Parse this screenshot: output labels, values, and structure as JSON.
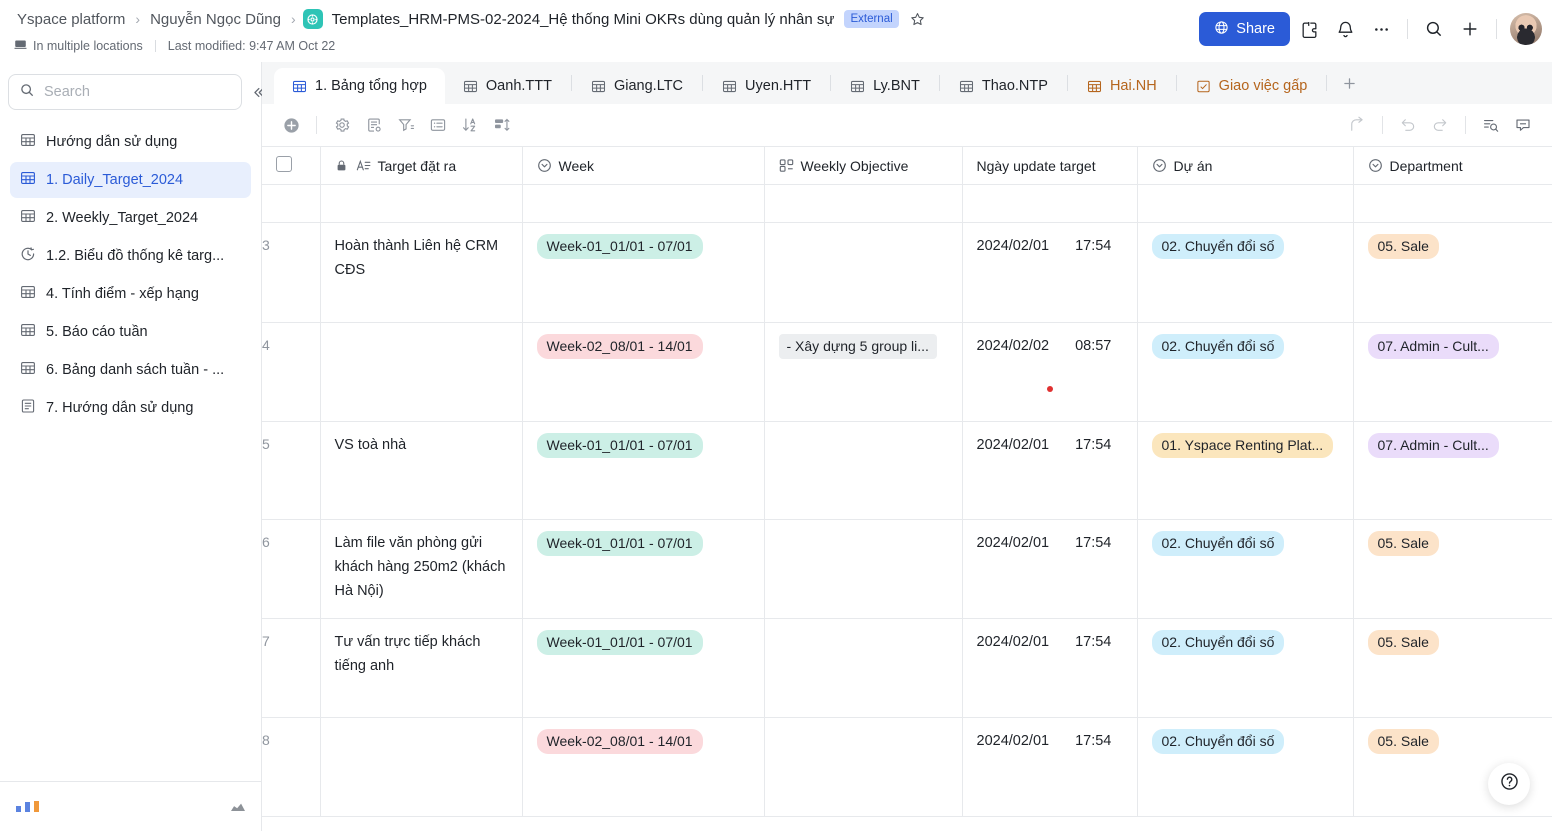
{
  "header": {
    "breadcrumbs": [
      {
        "label": "Yspace platform",
        "icon": ""
      },
      {
        "label": "Nguyễn Ngọc Dũng",
        "icon": ""
      }
    ],
    "separator": "›",
    "doc_icon": "base-table-icon",
    "doc_title": "Templates_HRM-PMS-02-2024_Hệ thống Mini OKRs dùng quản lý nhân sự",
    "external_badge": "External",
    "star_icon": "star-outline-icon",
    "location_icon": "multiple-locations-icon",
    "location_text": "In multiple locations",
    "last_modified": "Last modified: 9:47 AM Oct 22",
    "share_label": "Share",
    "share_icon": "globe-icon",
    "share_color": "#2b5bd7",
    "actions": [
      {
        "name": "extensions-icon"
      },
      {
        "name": "bell-icon"
      },
      {
        "name": "more-horizontal-icon"
      },
      {
        "name": "search-icon"
      },
      {
        "name": "plus-icon"
      }
    ],
    "avatar": "user-avatar"
  },
  "sidebar": {
    "search": {
      "placeholder": "Search",
      "value": "",
      "icon": "search-icon"
    },
    "collapse_icon": "chevrons-left-icon",
    "items": [
      {
        "label": "Hướng dẫn sử dụng",
        "icon": "grid-table-icon",
        "active": false
      },
      {
        "label": "1. Daily_Target_2024",
        "icon": "grid-table-icon",
        "active": true
      },
      {
        "label": "2. Weekly_Target_2024",
        "icon": "grid-table-icon",
        "active": false
      },
      {
        "label": "1.2. Biểu đồ thống kê targ...",
        "icon": "dashboard-clock-icon",
        "active": false
      },
      {
        "label": "4. Tính điểm - xếp hạng",
        "icon": "grid-table-icon",
        "active": false
      },
      {
        "label": "5. Báo cáo tuần",
        "icon": "grid-table-icon",
        "active": false
      },
      {
        "label": "6. Bảng danh sách tuần - ...",
        "icon": "grid-table-icon",
        "active": false
      },
      {
        "label": "7. Hướng dẫn sử dụng",
        "icon": "document-icon",
        "active": false
      }
    ]
  },
  "tabs": {
    "items": [
      {
        "label": "1. Bảng tổng hợp",
        "icon": "grid-table-icon",
        "active": true,
        "warn": false
      },
      {
        "label": "Oanh.TTT",
        "icon": "grid-table-icon",
        "active": false,
        "warn": false
      },
      {
        "label": "Giang.LTC",
        "icon": "grid-table-icon",
        "active": false,
        "warn": false
      },
      {
        "label": "Uyen.HTT",
        "icon": "grid-table-icon",
        "active": false,
        "warn": false
      },
      {
        "label": "Ly.BNT",
        "icon": "grid-table-icon",
        "active": false,
        "warn": false
      },
      {
        "label": "Thao.NTP",
        "icon": "grid-table-icon",
        "active": false,
        "warn": false
      },
      {
        "label": "Hai.NH",
        "icon": "grid-table-icon",
        "active": false,
        "warn": true
      },
      {
        "label": "Giao việc gấp",
        "icon": "checklist-icon",
        "active": false,
        "warn": true
      }
    ],
    "add_icon": "plus-icon",
    "warn_color": "#b5651d"
  },
  "toolbar": {
    "left": [
      {
        "name": "add-record-icon"
      },
      {
        "name": "settings-gear-icon"
      },
      {
        "name": "form-settings-icon"
      },
      {
        "name": "filter-icon"
      },
      {
        "name": "field-config-icon"
      },
      {
        "name": "sort-az-icon"
      },
      {
        "name": "group-icon"
      }
    ],
    "right": [
      {
        "name": "share-arrow-icon",
        "disabled": true
      },
      {
        "name": "undo-icon",
        "disabled": true
      },
      {
        "name": "redo-icon",
        "disabled": true
      },
      {
        "name": "find-replace-icon",
        "disabled": false
      },
      {
        "name": "comment-icon",
        "disabled": false
      }
    ]
  },
  "grid": {
    "select_all": {
      "checked": false
    },
    "columns": [
      {
        "label": "Target đặt ra",
        "icon": "text-field-icon",
        "locked": true
      },
      {
        "label": "Week",
        "icon": "single-select-icon",
        "locked": false
      },
      {
        "label": "Weekly Objective",
        "icon": "lookup-icon",
        "locked": false
      },
      {
        "label": "Ngày update target",
        "icon": "",
        "locked": false
      },
      {
        "label": "Dự án",
        "icon": "single-select-icon",
        "locked": false
      },
      {
        "label": "Department",
        "icon": "single-select-icon",
        "locked": false
      }
    ],
    "rows": [
      {
        "num": "3",
        "target": "Hoàn thành Liên hệ CRM CĐS",
        "week": {
          "text": "Week-01_01/01 - 07/01",
          "bg": "#ccefe6"
        },
        "objective": null,
        "date": "2024/02/01",
        "time": "17:54",
        "has_dot": false,
        "project": {
          "text": "02. Chuyển đổi số",
          "bg": "#cfeefb"
        },
        "department": {
          "text": "05. Sale",
          "bg": "#fce3c9"
        }
      },
      {
        "num": "4",
        "target": "",
        "week": {
          "text": "Week-02_08/01 - 14/01",
          "bg": "#fbd9dc"
        },
        "objective": {
          "text": "- Xây dựng 5 group li...",
          "bg": "#eceef0"
        },
        "date": "2024/02/02",
        "time": "08:57",
        "has_dot": true,
        "project": {
          "text": "02. Chuyển đổi số",
          "bg": "#cfeefb"
        },
        "department": {
          "text": "07. Admin - Cult...",
          "bg": "#eadcfa"
        }
      },
      {
        "num": "5",
        "target": "VS toà nhà",
        "week": {
          "text": "Week-01_01/01 - 07/01",
          "bg": "#ccefe6"
        },
        "objective": null,
        "date": "2024/02/01",
        "time": "17:54",
        "has_dot": false,
        "project": {
          "text": "01. Yspace Renting Plat...",
          "bg": "#fbe6bd"
        },
        "department": {
          "text": "07. Admin - Cult...",
          "bg": "#eadcfa"
        }
      },
      {
        "num": "6",
        "target": "Làm file văn phòng gửi khách hàng 250m2 (khách Hà Nội)",
        "week": {
          "text": "Week-01_01/01 - 07/01",
          "bg": "#ccefe6"
        },
        "objective": null,
        "date": "2024/02/01",
        "time": "17:54",
        "has_dot": false,
        "project": {
          "text": "02. Chuyển đổi số",
          "bg": "#cfeefb"
        },
        "department": {
          "text": "05. Sale",
          "bg": "#fce3c9"
        }
      },
      {
        "num": "7",
        "target": "Tư vấn trực tiếp khách tiếng anh",
        "week": {
          "text": "Week-01_01/01 - 07/01",
          "bg": "#ccefe6"
        },
        "objective": null,
        "date": "2024/02/01",
        "time": "17:54",
        "has_dot": false,
        "project": {
          "text": "02. Chuyển đổi số",
          "bg": "#cfeefb"
        },
        "department": {
          "text": "05. Sale",
          "bg": "#fce3c9"
        }
      },
      {
        "num": "8",
        "target": "",
        "week": {
          "text": "Week-02_08/01 - 14/01",
          "bg": "#fbd9dc"
        },
        "objective": null,
        "date": "2024/02/01",
        "time": "17:54",
        "has_dot": false,
        "project": {
          "text": "02. Chuyển đổi số",
          "bg": "#cfeefb"
        },
        "department": {
          "text": "05. Sale",
          "bg": "#fce3c9"
        }
      }
    ]
  },
  "help": {
    "icon": "question-circle-icon"
  }
}
